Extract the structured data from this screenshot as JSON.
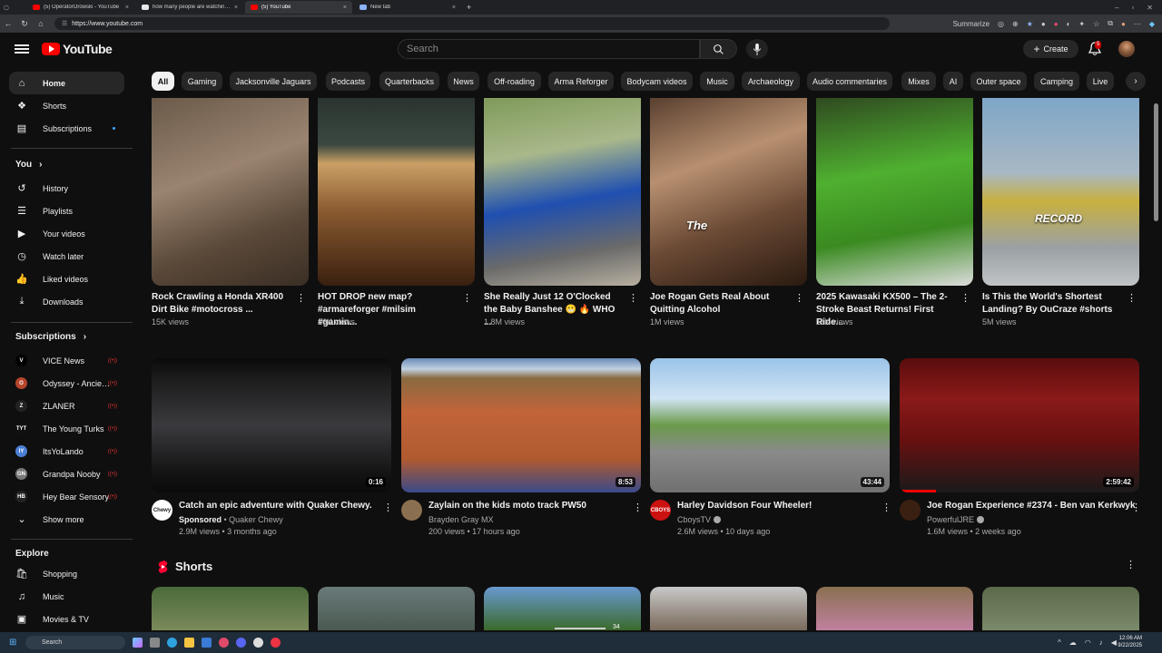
{
  "browser": {
    "tabs": [
      {
        "title": "(5) OperatorOrowski - YouTube",
        "active": false,
        "color": "#ff0000"
      },
      {
        "title": "how many people are watching l...",
        "active": false,
        "color": "#e8e8e8"
      },
      {
        "title": "(5) YouTube",
        "active": true,
        "color": "#ff0000"
      },
      {
        "title": "New tab",
        "active": false,
        "color": "#8ab4f8"
      }
    ],
    "url": "https://www.youtube.com",
    "summarize_label": "Summarize"
  },
  "header": {
    "logo_text": "YouTube",
    "search_placeholder": "Search",
    "create_label": "Create",
    "notification_count": "5"
  },
  "sidebar": {
    "main": [
      {
        "label": "Home",
        "icon": "home-icon",
        "active": true
      },
      {
        "label": "Shorts",
        "icon": "shorts-icon"
      },
      {
        "label": "Subscriptions",
        "icon": "subscriptions-icon"
      }
    ],
    "you_heading": "You",
    "you": [
      {
        "label": "History",
        "icon": "history-icon"
      },
      {
        "label": "Playlists",
        "icon": "playlists-icon"
      },
      {
        "label": "Your videos",
        "icon": "your-videos-icon"
      },
      {
        "label": "Watch later",
        "icon": "watch-later-icon"
      },
      {
        "label": "Liked videos",
        "icon": "like-icon"
      },
      {
        "label": "Downloads",
        "icon": "download-icon"
      }
    ],
    "subs_heading": "Subscriptions",
    "subs": [
      {
        "label": "VICE News",
        "badge": "V",
        "color": "#ffffff",
        "bg": "#000000"
      },
      {
        "label": "Odyssey - Ancien...",
        "badge": "O",
        "color": "#ffffff",
        "bg": "#b5452d"
      },
      {
        "label": "ZLANER",
        "badge": "Z",
        "color": "#ffffff",
        "bg": "#222222"
      },
      {
        "label": "The Young Turks",
        "badge": "TYT",
        "color": "#ffffff",
        "bg": "#111111"
      },
      {
        "label": "ItsYoLando",
        "badge": "IY",
        "color": "#ffffff",
        "bg": "#4c7fd4"
      },
      {
        "label": "Grandpa Nooby",
        "badge": "GN",
        "color": "#ffffff",
        "bg": "#777777"
      },
      {
        "label": "Hey Bear Sensory",
        "badge": "HB",
        "color": "#ffffff",
        "bg": "#222222"
      }
    ],
    "show_more": "Show more",
    "explore_heading": "Explore",
    "explore": [
      {
        "label": "Shopping",
        "icon": "shopping-icon"
      },
      {
        "label": "Music",
        "icon": "music-icon"
      },
      {
        "label": "Movies & TV",
        "icon": "movies-icon"
      }
    ]
  },
  "chips": [
    "All",
    "Gaming",
    "Jacksonville Jaguars",
    "Podcasts",
    "Quarterbacks",
    "News",
    "Off-roading",
    "Arma Reforger",
    "Bodycam videos",
    "Music",
    "Archaeology",
    "Audio commentaries",
    "Mixes",
    "AI",
    "Outer space",
    "Camping",
    "Live"
  ],
  "shorts_row": [
    {
      "title": "Rock Crawling a Honda XR400 Dirt Bike  #motocross ...",
      "views": "15K views"
    },
    {
      "title": "HOT DROP new map? #armareforger #milsim #gamin...",
      "views": "16K views"
    },
    {
      "title": "She Really Just 12 O'Clocked the Baby Banshee 😬 🔥 WHO ...",
      "views": "1.8M views"
    },
    {
      "title": "Joe Rogan Gets Real About Quitting Alcohol",
      "views": "1M views",
      "overlay": "The"
    },
    {
      "title": "2025 Kawasaki KX500 – The 2-Stroke Beast Returns! First Ride...",
      "views": "11K views"
    },
    {
      "title": "Is This the World's Shortest Landing? By OuCraze #shorts",
      "views": "5M views",
      "overlay": "RECORD"
    }
  ],
  "videos": [
    {
      "title": "Catch an epic adventure with Quaker Chewy.",
      "sponsored": "Sponsored",
      "channel": "Quaker Chewy",
      "meta": "2.9M views • 3 months ago",
      "duration": "0:16",
      "avatar": "Chewy"
    },
    {
      "title": "Zaylain on the kids moto track PW50",
      "channel": "Brayden Gray MX",
      "meta": "200 views • 17 hours ago",
      "duration": "8:53",
      "avatar": ""
    },
    {
      "title": "Harley Davidson Four Wheeler!",
      "channel": "CboysTV",
      "meta": "2.6M views • 10 days ago",
      "duration": "43:44",
      "avatar": "CBOYS"
    },
    {
      "title": "Joe Rogan Experience #2374 - Ben van Kerkwyk",
      "channel": "PowerfulJRE",
      "meta": "1.6M views • 2 weeks ago",
      "duration": "2:59:42",
      "avatar": ""
    }
  ],
  "shorts_heading": "Shorts",
  "bottom_row_overlay": "34",
  "taskbar": {
    "search_placeholder": "Search",
    "time": "12:06 AM",
    "date": "9/22/2025"
  }
}
